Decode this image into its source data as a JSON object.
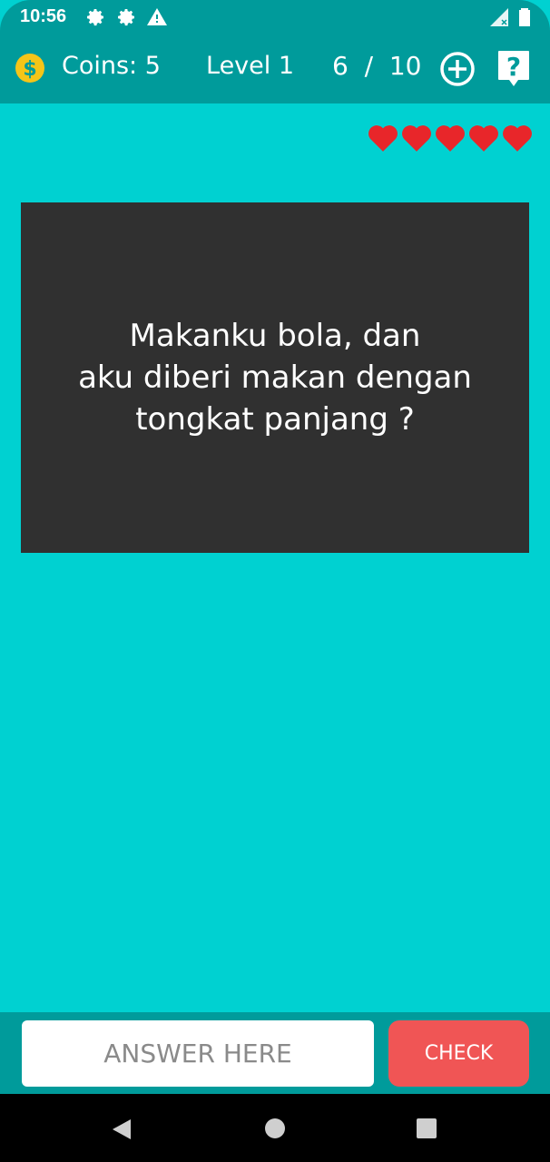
{
  "status_bar": {
    "time": "10:56",
    "icons": [
      "gear-icon",
      "gear-icon",
      "warning-icon",
      "signal-icon",
      "battery-icon"
    ]
  },
  "header": {
    "coins_label": "Coins: 5",
    "level_label": "Level 1",
    "progress_label": "6  /  10",
    "add_icon": "plus-circle-icon",
    "help_icon": "question-bubble-icon"
  },
  "lives": {
    "count": 5,
    "color": "#e8262a"
  },
  "question": {
    "text": "Makanku bola, dan\naku diberi makan dengan\ntongkat panjang ?"
  },
  "answer": {
    "placeholder": "ANSWER HERE",
    "value": "",
    "check_label": "CHECK"
  },
  "colors": {
    "background": "#00d1d1",
    "bar": "#009b9b",
    "card": "#303030",
    "check_button": "#f05555",
    "coin": "#f5c518"
  },
  "nav": {
    "buttons": [
      "back-icon",
      "home-icon",
      "recents-icon"
    ]
  }
}
